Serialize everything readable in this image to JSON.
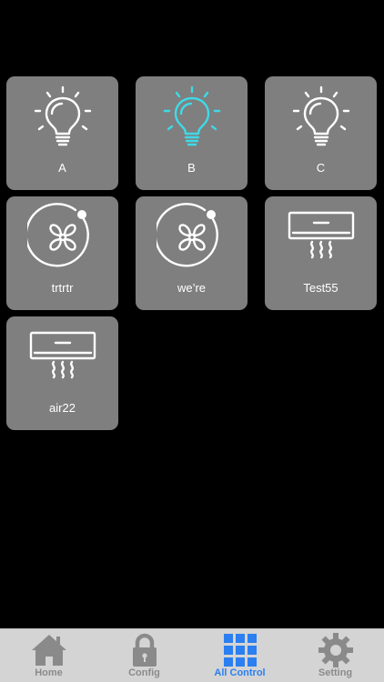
{
  "colors": {
    "tile_bg": "#7f7f7f",
    "icon_default": "#ffffff",
    "icon_active": "#3fd9e6",
    "tab_inactive": "#8a8a8a",
    "tab_active": "#2b7ff0",
    "tabbar_bg": "#d4d4d4"
  },
  "devices": [
    {
      "label": "A",
      "icon": "bulb-icon",
      "active": false
    },
    {
      "label": "B",
      "icon": "bulb-icon",
      "active": true
    },
    {
      "label": "C",
      "icon": "bulb-icon",
      "active": false
    },
    {
      "label": "trtrtr",
      "icon": "fan-icon",
      "active": false
    },
    {
      "label": "we’re",
      "icon": "fan-icon",
      "active": false
    },
    {
      "label": "Test55",
      "icon": "air-conditioner-icon",
      "active": false
    },
    {
      "label": "air22",
      "icon": "air-conditioner-icon",
      "active": false
    }
  ],
  "tabs": [
    {
      "label": "Home",
      "icon": "home-icon",
      "active": false
    },
    {
      "label": "Config",
      "icon": "lock-icon",
      "active": false
    },
    {
      "label": "All Control",
      "icon": "grid-icon",
      "active": true
    },
    {
      "label": "Setting",
      "icon": "gear-icon",
      "active": false
    }
  ]
}
